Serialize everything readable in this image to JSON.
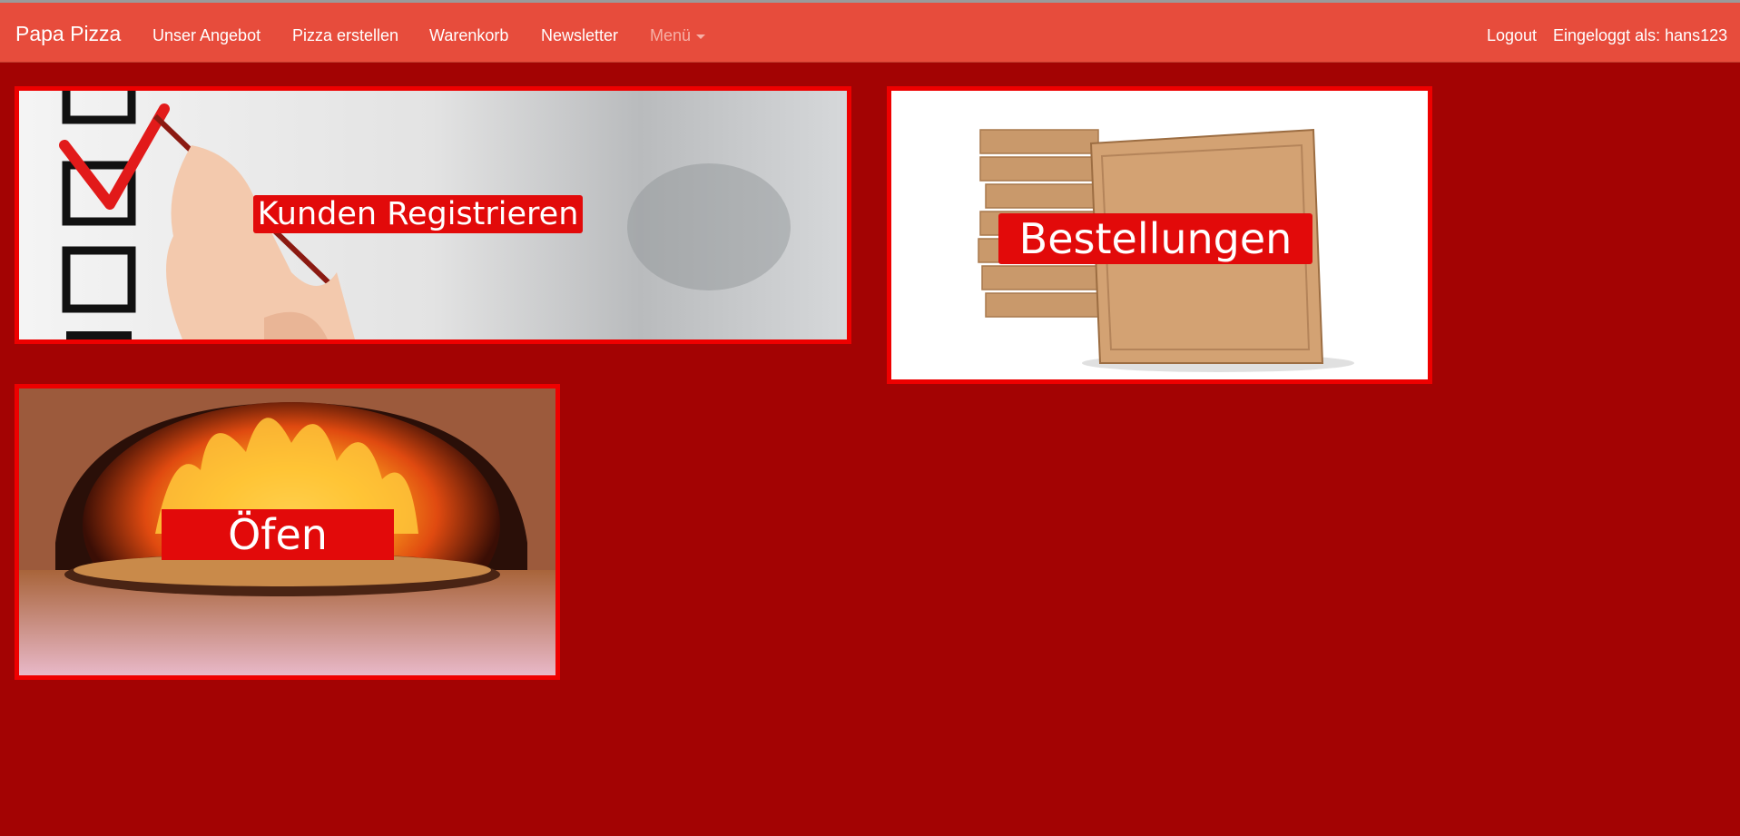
{
  "navbar": {
    "brand": "Papa Pizza",
    "items": [
      {
        "label": "Unser Angebot"
      },
      {
        "label": "Pizza erstellen"
      },
      {
        "label": "Warenkorb"
      },
      {
        "label": "Newsletter"
      },
      {
        "label": "Menü"
      }
    ],
    "logout": "Logout",
    "user_status": "Eingeloggt als: hans123"
  },
  "tiles": [
    {
      "label": "Kunden Registrieren"
    },
    {
      "label": "Bestellungen"
    },
    {
      "label": "Öfen"
    }
  ],
  "colors": {
    "navbar": "#e74c3c",
    "background": "#a30303",
    "tile_border": "#ee0000",
    "label_bg": "#e20a0a"
  }
}
